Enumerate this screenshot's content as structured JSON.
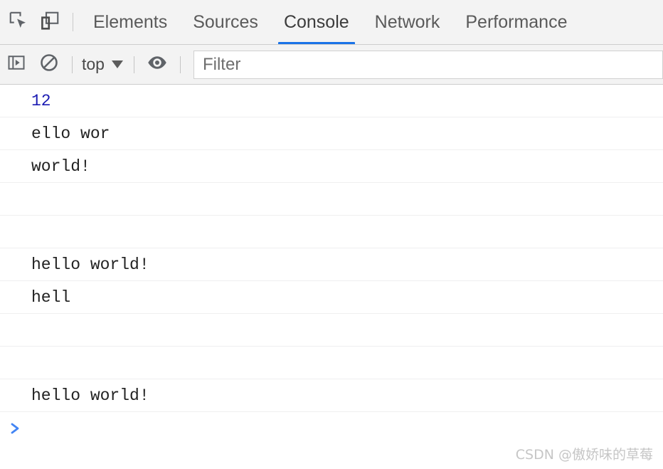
{
  "devtools": {
    "tabbar": {
      "inspect_icon": "inspect-element-icon",
      "device_icon": "device-toolbar-icon",
      "tabs": [
        {
          "label": "Elements",
          "active": false
        },
        {
          "label": "Sources",
          "active": false
        },
        {
          "label": "Console",
          "active": true
        },
        {
          "label": "Network",
          "active": false
        },
        {
          "label": "Performance",
          "active": false
        }
      ],
      "active_tab": "Console",
      "accent_color": "#1a73e8"
    },
    "console_toolbar": {
      "sidebar_toggle_icon": "console-sidebar-icon",
      "clear_console_icon": "clear-console-icon",
      "context_label": "top",
      "context_caret_icon": "chevron-down-icon",
      "live_expression_icon": "eye-icon",
      "filter_placeholder": "Filter",
      "filter_value": ""
    },
    "console_messages": [
      {
        "text": "12",
        "kind": "number"
      },
      {
        "text": "ello wor",
        "kind": "string"
      },
      {
        "text": "world!",
        "kind": "string"
      },
      {
        "text": "",
        "kind": "blank"
      },
      {
        "text": "",
        "kind": "blank"
      },
      {
        "text": "hello world!",
        "kind": "string"
      },
      {
        "text": "hell",
        "kind": "string"
      },
      {
        "text": "",
        "kind": "blank"
      },
      {
        "text": "",
        "kind": "blank"
      },
      {
        "text": "hello world!",
        "kind": "string"
      }
    ],
    "prompt": {
      "chevron_icon": "prompt-chevron-icon",
      "value": "",
      "chevron_color": "#4285f4"
    },
    "watermark": "CSDN @傲娇味的草莓"
  }
}
